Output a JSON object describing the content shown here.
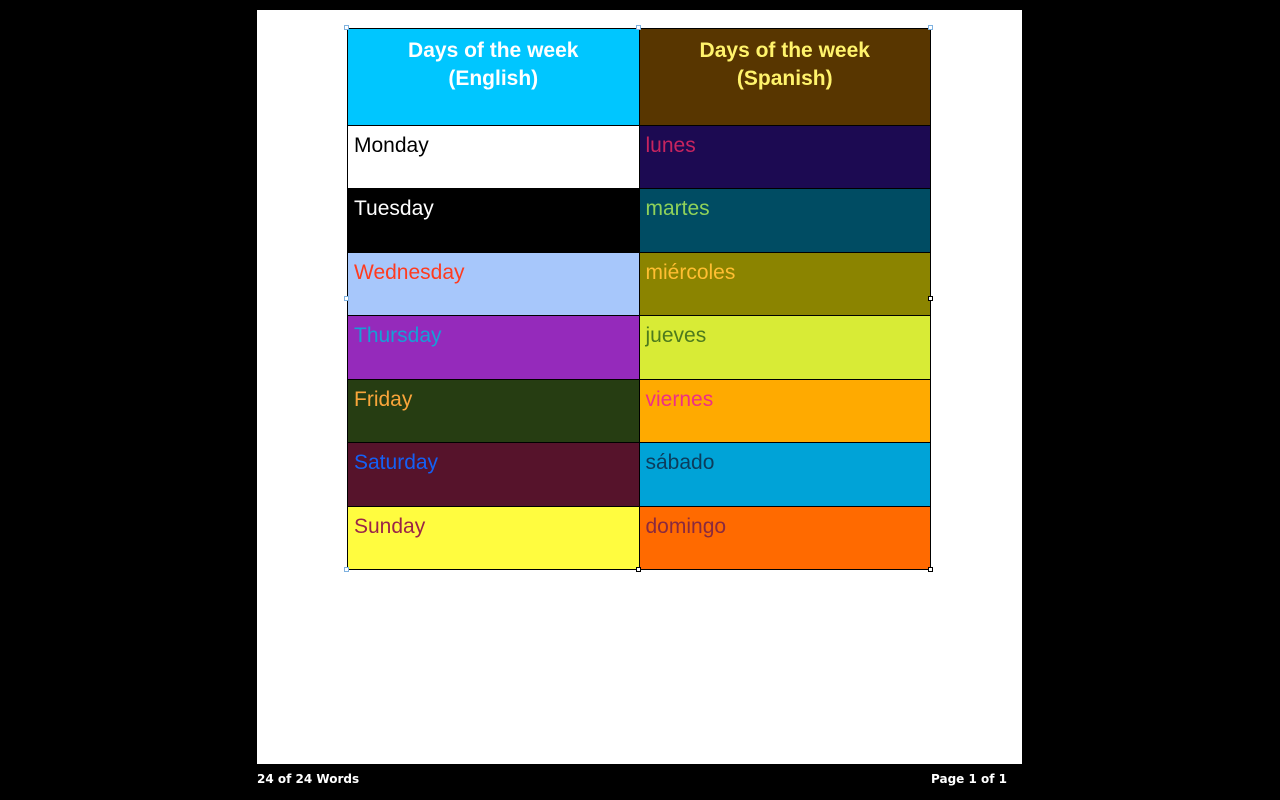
{
  "document": {
    "table": {
      "headers": [
        {
          "line1": "Days of the week",
          "line2": "(English)",
          "bg": "#00c6ff",
          "color": "#ffffff"
        },
        {
          "line1": "Days of the week",
          "line2": "(Spanish)",
          "bg": "#583600",
          "color": "#fff36b"
        }
      ],
      "rows": [
        {
          "english": {
            "text": "Monday",
            "bg": "#ffffff",
            "color": "#000000"
          },
          "spanish": {
            "text": "lunes",
            "bg": "#1c0a52",
            "color": "#c8245f"
          }
        },
        {
          "english": {
            "text": "Tuesday",
            "bg": "#000000",
            "color": "#ffffff"
          },
          "spanish": {
            "text": "martes",
            "bg": "#004c63",
            "color": "#8fd25a"
          }
        },
        {
          "english": {
            "text": "Wednesday",
            "bg": "#a7c7fb",
            "color": "#ff3b1f"
          },
          "spanish": {
            "text": "miércoles",
            "bg": "#8b8400",
            "color": "#ffbe31"
          }
        },
        {
          "english": {
            "text": "Thursday",
            "bg": "#952abb",
            "color": "#169fd6"
          },
          "spanish": {
            "text": "jueves",
            "bg": "#d8eb36",
            "color": "#4d7a1d"
          }
        },
        {
          "english": {
            "text": "Friday",
            "bg": "#263d12",
            "color": "#f9a53a"
          },
          "spanish": {
            "text": "viernes",
            "bg": "#ffaa00",
            "color": "#ee2f86"
          }
        },
        {
          "english": {
            "text": "Saturday",
            "bg": "#56132b",
            "color": "#1460f5"
          },
          "spanish": {
            "text": "sábado",
            "bg": "#00a3d7",
            "color": "#0c3c5c"
          }
        },
        {
          "english": {
            "text": "Sunday",
            "bg": "#fffc3f",
            "color": "#9a2548"
          },
          "spanish": {
            "text": "domingo",
            "bg": "#ff6a00",
            "color": "#892a3f"
          }
        }
      ]
    }
  },
  "status_bar": {
    "word_count": "24 of 24 Words",
    "page_indicator": "Page 1 of 1"
  }
}
